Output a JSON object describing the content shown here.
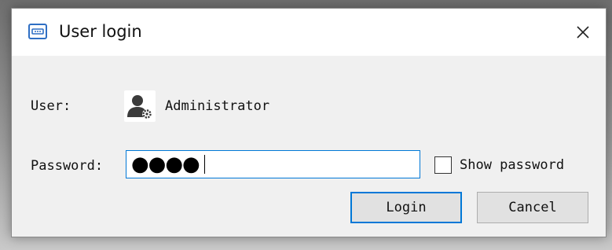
{
  "dialog": {
    "title": "User login",
    "title_icon": "login-window-icon",
    "close_icon": "close-icon"
  },
  "user": {
    "label": "User:",
    "avatar_icon": "user-settings-icon",
    "name": "Administrator"
  },
  "password": {
    "label": "Password:",
    "masked_value": "●●●●"
  },
  "show_password": {
    "label": "Show password",
    "checked": false
  },
  "buttons": {
    "login_label": "Login",
    "cancel_label": "Cancel"
  },
  "colors": {
    "focus_blue": "#0078d7",
    "dialog_bg": "#f0f0f0",
    "titlebar_bg": "#ffffff",
    "button_bg": "#e1e1e1"
  }
}
